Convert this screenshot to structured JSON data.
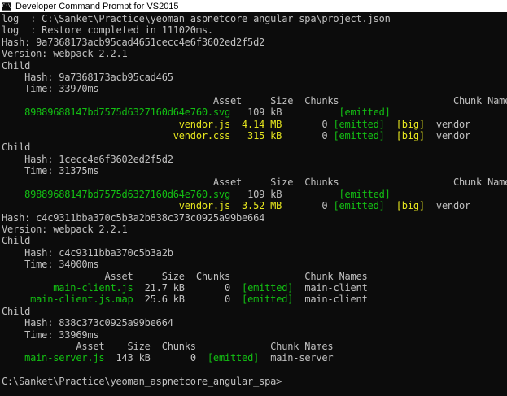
{
  "window": {
    "title": "Developer Command Prompt for VS2015",
    "icon": "console-icon",
    "icon_glyph": "C:\\"
  },
  "colors": {
    "background": "#0c0c0c",
    "text": "#c0c0c0",
    "green": "#13c013",
    "yellow": "#e6e61e"
  },
  "console": {
    "lines": [
      [
        {
          "t": "log  : C:\\Sanket\\Practice\\yeoman_aspnetcore_angular_spa\\project.json",
          "c": "gray"
        }
      ],
      [
        {
          "t": "log  : Restore completed in 111020ms.",
          "c": "gray"
        }
      ],
      [
        {
          "t": "Hash: 9a7368173acb95cad4651cecc4e6f3602ed2f5d2",
          "c": "gray"
        }
      ],
      [
        {
          "t": "Version: webpack 2.2.1",
          "c": "gray"
        }
      ],
      [
        {
          "t": "Child",
          "c": "gray"
        }
      ],
      [
        {
          "t": "    Hash: 9a7368173acb95cad465",
          "c": "gray"
        }
      ],
      [
        {
          "t": "    Time: 33970ms",
          "c": "gray"
        }
      ],
      [
        {
          "t": "                                     Asset     Size  Chunks                    Chunk Names",
          "c": "gray"
        }
      ],
      [
        {
          "t": "    89889688147bd7575d6327160d64e760.svg",
          "c": "green"
        },
        {
          "t": "   109 kB          ",
          "c": "gray"
        },
        {
          "t": "[emitted]",
          "c": "green"
        }
      ],
      [
        {
          "t": "                               vendor.js  4.14 MB",
          "c": "yellow"
        },
        {
          "t": "       0 ",
          "c": "gray"
        },
        {
          "t": "[emitted]",
          "c": "green"
        },
        {
          "t": "  ",
          "c": "gray"
        },
        {
          "t": "[big]",
          "c": "yellow"
        },
        {
          "t": "  vendor",
          "c": "gray"
        }
      ],
      [
        {
          "t": "                              vendor.css   315 kB",
          "c": "yellow"
        },
        {
          "t": "       0 ",
          "c": "gray"
        },
        {
          "t": "[emitted]",
          "c": "green"
        },
        {
          "t": "  ",
          "c": "gray"
        },
        {
          "t": "[big]",
          "c": "yellow"
        },
        {
          "t": "  vendor",
          "c": "gray"
        }
      ],
      [
        {
          "t": "Child",
          "c": "gray"
        }
      ],
      [
        {
          "t": "    Hash: 1cecc4e6f3602ed2f5d2",
          "c": "gray"
        }
      ],
      [
        {
          "t": "    Time: 31375ms",
          "c": "gray"
        }
      ],
      [
        {
          "t": "                                     Asset     Size  Chunks                    Chunk Names",
          "c": "gray"
        }
      ],
      [
        {
          "t": "    89889688147bd7575d6327160d64e760.svg",
          "c": "green"
        },
        {
          "t": "   109 kB          ",
          "c": "gray"
        },
        {
          "t": "[emitted]",
          "c": "green"
        }
      ],
      [
        {
          "t": "                               vendor.js  3.52 MB",
          "c": "yellow"
        },
        {
          "t": "       0 ",
          "c": "gray"
        },
        {
          "t": "[emitted]",
          "c": "green"
        },
        {
          "t": "  ",
          "c": "gray"
        },
        {
          "t": "[big]",
          "c": "yellow"
        },
        {
          "t": "  vendor",
          "c": "gray"
        }
      ],
      [
        {
          "t": "Hash: c4c9311bba370c5b3a2b838c373c0925a99be664",
          "c": "gray"
        }
      ],
      [
        {
          "t": "Version: webpack 2.2.1",
          "c": "gray"
        }
      ],
      [
        {
          "t": "Child",
          "c": "gray"
        }
      ],
      [
        {
          "t": "    Hash: c4c9311bba370c5b3a2b",
          "c": "gray"
        }
      ],
      [
        {
          "t": "    Time: 34000ms",
          "c": "gray"
        }
      ],
      [
        {
          "t": "                  Asset     Size  Chunks             Chunk Names",
          "c": "gray"
        }
      ],
      [
        {
          "t": "         main-client.js",
          "c": "green"
        },
        {
          "t": "  21.7 kB       0  ",
          "c": "gray"
        },
        {
          "t": "[emitted]",
          "c": "green"
        },
        {
          "t": "  main-client",
          "c": "gray"
        }
      ],
      [
        {
          "t": "     main-client.js.map",
          "c": "green"
        },
        {
          "t": "  25.6 kB       0  ",
          "c": "gray"
        },
        {
          "t": "[emitted]",
          "c": "green"
        },
        {
          "t": "  main-client",
          "c": "gray"
        }
      ],
      [
        {
          "t": "Child",
          "c": "gray"
        }
      ],
      [
        {
          "t": "    Hash: 838c373c0925a99be664",
          "c": "gray"
        }
      ],
      [
        {
          "t": "    Time: 33969ms",
          "c": "gray"
        }
      ],
      [
        {
          "t": "             Asset    Size  Chunks             Chunk Names",
          "c": "gray"
        }
      ],
      [
        {
          "t": "    main-server.js",
          "c": "green"
        },
        {
          "t": "  143 kB       0  ",
          "c": "gray"
        },
        {
          "t": "[emitted]",
          "c": "green"
        },
        {
          "t": "  main-server",
          "c": "gray"
        }
      ],
      [
        {
          "t": "",
          "c": "gray"
        }
      ],
      [
        {
          "t": "C:\\Sanket\\Practice\\yeoman_aspnetcore_angular_spa>",
          "c": "gray"
        }
      ]
    ]
  }
}
